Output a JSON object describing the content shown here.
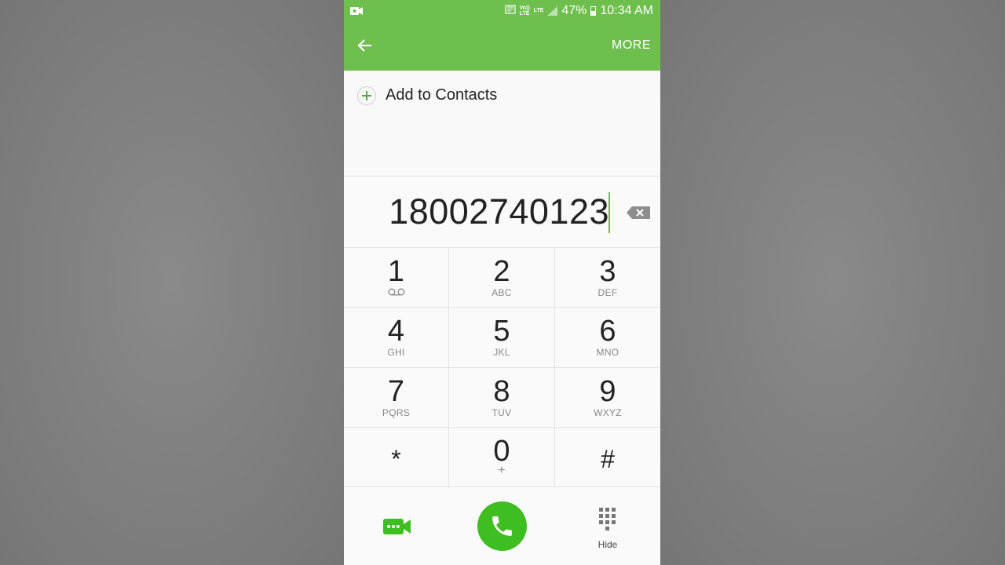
{
  "status_bar": {
    "volte": "Vo))",
    "lte_small": "LTE",
    "lte": "LTE",
    "battery": "47%",
    "time": "10:34 AM"
  },
  "app_bar": {
    "more_label": "MORE"
  },
  "add_to_contacts": "Add to Contacts",
  "dialed_number": "18002740123",
  "keys": [
    {
      "digit": "1",
      "sub": ""
    },
    {
      "digit": "2",
      "sub": "ABC"
    },
    {
      "digit": "3",
      "sub": "DEF"
    },
    {
      "digit": "4",
      "sub": "GHI"
    },
    {
      "digit": "5",
      "sub": "JKL"
    },
    {
      "digit": "6",
      "sub": "MNO"
    },
    {
      "digit": "7",
      "sub": "PQRS"
    },
    {
      "digit": "8",
      "sub": "TUV"
    },
    {
      "digit": "9",
      "sub": "WXYZ"
    },
    {
      "digit": "*",
      "sub": ""
    },
    {
      "digit": "0",
      "sub": "+"
    },
    {
      "digit": "#",
      "sub": ""
    }
  ],
  "bottom": {
    "hide_label": "Hide"
  },
  "colors": {
    "accent": "#6fbf4f",
    "call_button": "#3fbe22",
    "plus": "#4caf3a"
  }
}
